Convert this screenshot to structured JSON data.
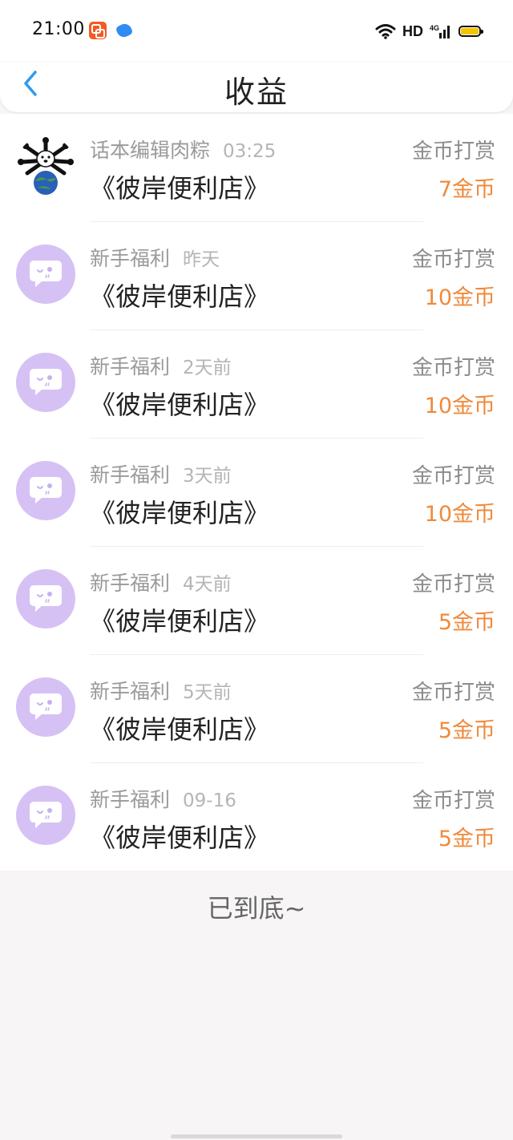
{
  "status_bar": {
    "time": "21:00",
    "network_label": "HD",
    "cell_label": "4G",
    "icons": [
      "app-notification-icon",
      "browser-notification-icon",
      "wifi-icon",
      "signal-icon",
      "battery-icon"
    ]
  },
  "header": {
    "title": "收益",
    "back_icon": "chevron-left-icon"
  },
  "colors": {
    "accent_blue": "#2f9bf0",
    "amount_orange": "#f08a3c",
    "avatar_purple": "#d6c1f5"
  },
  "records": [
    {
      "source": "话本编辑肉粽",
      "time": "03:25",
      "book": "《彼岸便利店》",
      "type": "金币打赏",
      "amount": "7金币",
      "avatar": "dog-avatar"
    },
    {
      "source": "新手福利",
      "time": "昨天",
      "book": "《彼岸便利店》",
      "type": "金币打赏",
      "amount": "10金币",
      "avatar": "chat-bubble-avatar"
    },
    {
      "source": "新手福利",
      "time": "2天前",
      "book": "《彼岸便利店》",
      "type": "金币打赏",
      "amount": "10金币",
      "avatar": "chat-bubble-avatar"
    },
    {
      "source": "新手福利",
      "time": "3天前",
      "book": "《彼岸便利店》",
      "type": "金币打赏",
      "amount": "10金币",
      "avatar": "chat-bubble-avatar"
    },
    {
      "source": "新手福利",
      "time": "4天前",
      "book": "《彼岸便利店》",
      "type": "金币打赏",
      "amount": "5金币",
      "avatar": "chat-bubble-avatar"
    },
    {
      "source": "新手福利",
      "time": "5天前",
      "book": "《彼岸便利店》",
      "type": "金币打赏",
      "amount": "5金币",
      "avatar": "chat-bubble-avatar"
    },
    {
      "source": "新手福利",
      "time": "09-16",
      "book": "《彼岸便利店》",
      "type": "金币打赏",
      "amount": "5金币",
      "avatar": "chat-bubble-avatar"
    }
  ],
  "footer": {
    "end_text": "已到底~"
  }
}
